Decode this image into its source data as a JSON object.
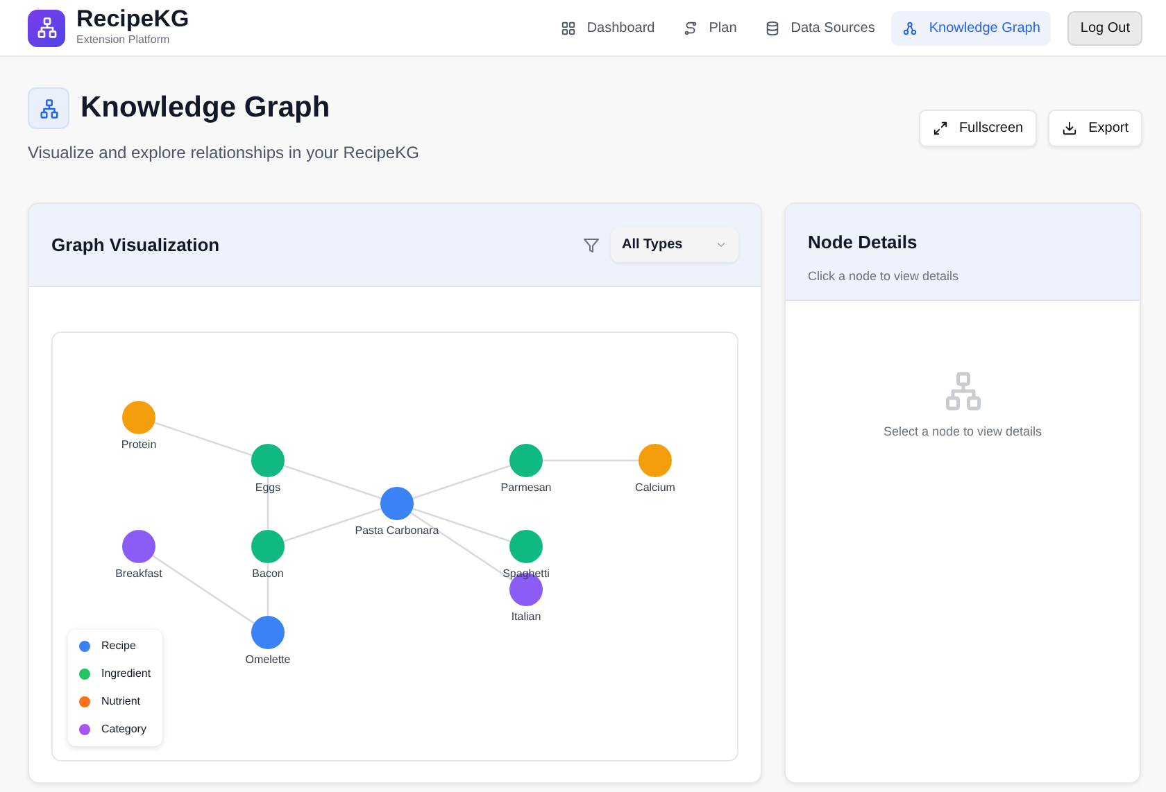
{
  "brand": {
    "name": "RecipeKG",
    "subtitle": "Extension Platform"
  },
  "nav": [
    {
      "label": "Dashboard",
      "selected": false
    },
    {
      "label": "Plan",
      "selected": false
    },
    {
      "label": "Data Sources",
      "selected": false
    },
    {
      "label": "Knowledge Graph",
      "selected": true
    }
  ],
  "logout": "Log Out",
  "page": {
    "title": "Knowledge Graph",
    "subtitle": "Visualize and explore relationships in your RecipeKG",
    "actions": [
      "Fullscreen",
      "Export"
    ]
  },
  "graph_card": {
    "title": "Graph Visualization",
    "filter": {
      "value": "All Types"
    },
    "nodes": [
      {
        "label": "Protein",
        "color": "#f59e0b"
      },
      {
        "label": "Eggs",
        "color": "#10b981"
      },
      {
        "label": "Pasta Carbonara",
        "color": "#3b82f6"
      },
      {
        "label": "Parmesan",
        "color": "#10b981"
      },
      {
        "label": "Calcium",
        "color": "#f59e0b"
      },
      {
        "label": "Breakfast",
        "color": "#8b5cf6"
      },
      {
        "label": "Bacon",
        "color": "#10b981"
      },
      {
        "label": "Spaghetti",
        "color": "#10b981"
      },
      {
        "label": "Italian",
        "color": "#8b5cf6"
      },
      {
        "label": "Omelette",
        "color": "#3b82f6"
      }
    ],
    "legend": [
      {
        "label": "Recipe",
        "color": "#3b82f6"
      },
      {
        "label": "Ingredient",
        "color": "#22c55e"
      },
      {
        "label": "Nutrient",
        "color": "#f97316"
      },
      {
        "label": "Category",
        "color": "#a855f7"
      }
    ]
  },
  "details_card": {
    "title": "Node Details",
    "subtitle": "Click a node to view details",
    "empty_text": "Select a node to view details"
  }
}
